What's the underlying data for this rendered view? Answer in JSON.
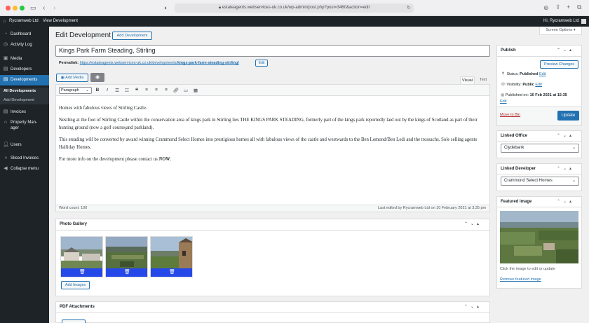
{
  "browser": {
    "url": "estateagents.webservices-uk.co.uk/wp-admin/post.php?post=3460&action=edit"
  },
  "adminbar": {
    "site_name": "Rycramweb Ltd",
    "view_link": "View Development",
    "greeting": "Hi, Rycramweb Ltd"
  },
  "sidebar": {
    "items": [
      {
        "label": "Dashboard",
        "icon": "dashboard-icon"
      },
      {
        "label": "Activity Log",
        "icon": "clock-icon"
      },
      {
        "label": "Media",
        "icon": "media-icon"
      },
      {
        "label": "Developers",
        "icon": "developers-icon"
      },
      {
        "label": "Developments",
        "icon": "developments-icon"
      },
      {
        "label": "Invoices",
        "icon": "invoices-icon"
      },
      {
        "label": "Property Manager",
        "icon": "property-icon"
      },
      {
        "label": "Users",
        "icon": "users-icon"
      },
      {
        "label": "Sliced Invoices",
        "icon": "sliced-icon"
      },
      {
        "label": "Collapse menu",
        "icon": "collapse-icon"
      }
    ],
    "property_label_line1": "Property Man-",
    "property_label_line2": "ager",
    "submenu": [
      "All Developments",
      "Add Development"
    ]
  },
  "page": {
    "heading": "Edit Development",
    "add_new": "Add Development",
    "screen_options": "Screen Options ▾",
    "title_value": "Kings Park Farm Steading, Stirling",
    "permalink_label": "Permalink:",
    "permalink_base": "https://estateagents.webservices-uk.co.uk/developments/",
    "permalink_slug": "kings-park-farm-steading-stirling/",
    "permalink_edit": "Edit",
    "add_media": "Add Media",
    "tab_visual": "Visual",
    "tab_text": "Text",
    "format_select": "Paragraph",
    "paragraphs": [
      "Homes with fabulous views of Stirling Castle.",
      "Nestling at the foot of Stirling Castle within the conservation area of kings park in Stirling lies THE KINGS PARK STEADING, formerly part of the kings park reportedly laid out by the kings of Scotland as part of their hunting ground (now a golf course and parkland).",
      "This steading will be converted by award winning Crammond Select Homes into prestigious homes all with fabulous views of the castle and westwards to the Ben Lomond/Ben Ledi and the trossachs. Sole selling agents Halliday Homes."
    ],
    "last_para_prefix": "For more info on the development please contact us ",
    "last_para_emphasis": "NOW",
    "last_para_suffix": ".",
    "word_count": "Word count: 100",
    "last_edited": "Last edited by Rycramweb Ltd on 10 February 2021 at 3:35 pm"
  },
  "gallery": {
    "title": "Photo Gallery",
    "add_images": "Add Images",
    "image_count": 3
  },
  "pdf": {
    "title": "PDF Attachments"
  },
  "publish": {
    "title": "Publish",
    "preview": "Preview Changes",
    "status_label": "Status:",
    "status_value": "Published",
    "status_edit": "Edit",
    "visibility_label": "Visibility:",
    "visibility_value": "Public",
    "visibility_edit": "Edit",
    "published_label": "Published on:",
    "published_value": "10 Feb 2021 at 15:35",
    "published_edit": "Edit",
    "trash": "Move to Bin",
    "update": "Update"
  },
  "linked_office": {
    "title": "Linked Office",
    "value": "Clydebank"
  },
  "linked_developer": {
    "title": "Linked Developer",
    "value": "Crammond Select Homes"
  },
  "featured": {
    "title": "Featured image",
    "hint": "Click the image to edit or update",
    "remove": "Remove featured image"
  },
  "colors": {
    "wp_blue": "#2271b1",
    "admin_dark": "#1d2327",
    "trash_red": "#b32d2e",
    "gallery_bar": "#2548e8"
  }
}
